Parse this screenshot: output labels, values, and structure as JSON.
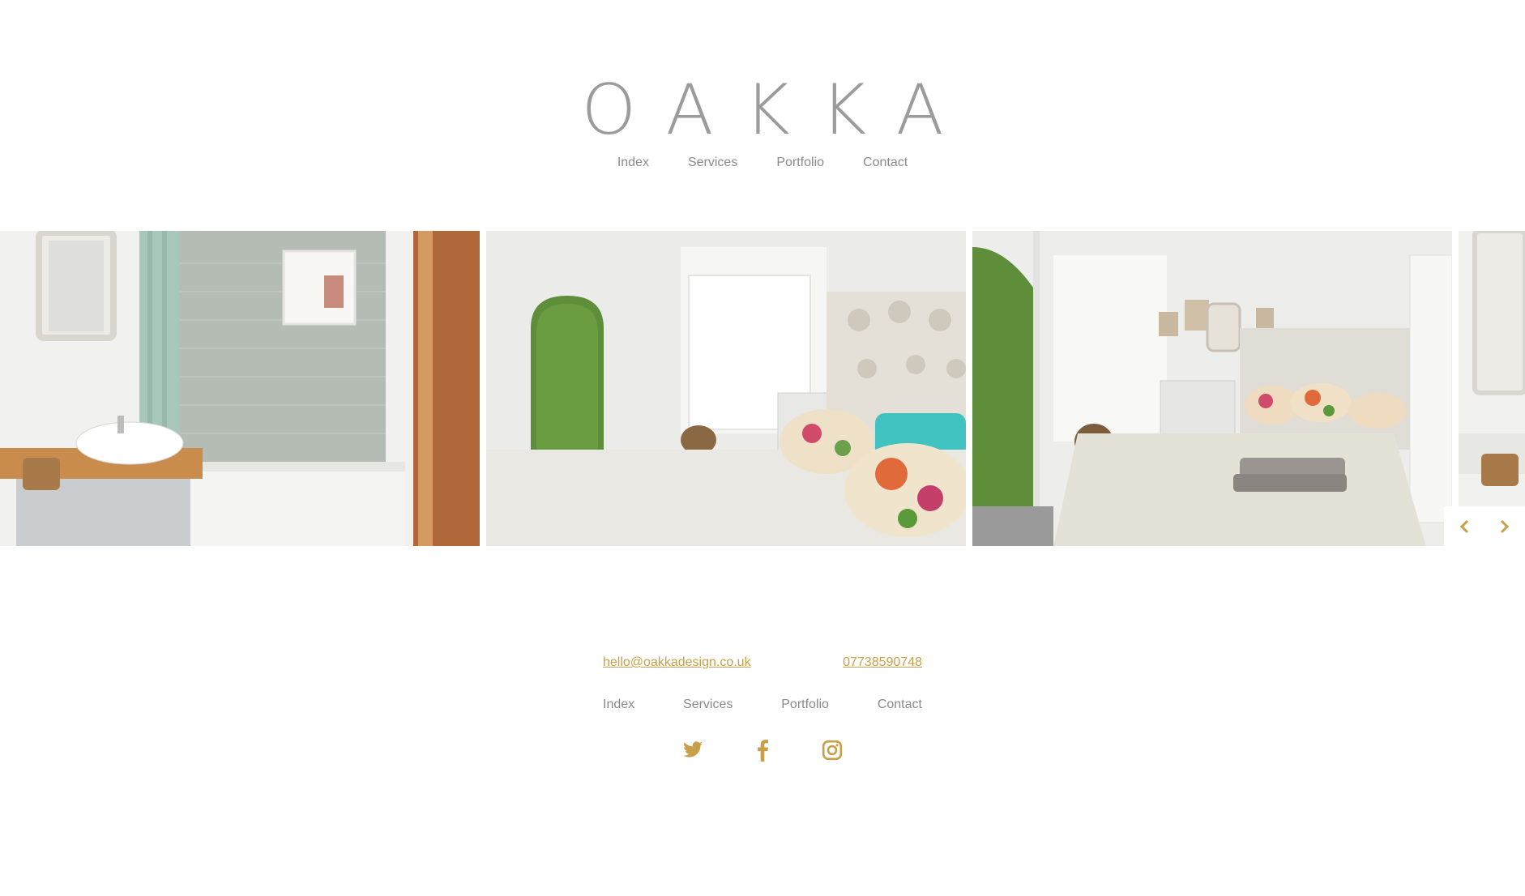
{
  "brand": {
    "logo_text": "OAKKA"
  },
  "main_nav": {
    "items": [
      {
        "label": "Index"
      },
      {
        "label": "Services"
      },
      {
        "label": "Portfolio"
      },
      {
        "label": "Contact"
      }
    ]
  },
  "gallery": {
    "slides": [
      {
        "subject": "bathroom"
      },
      {
        "subject": "bedroom-window"
      },
      {
        "subject": "bedroom-bed"
      },
      {
        "subject": "bathroom-partial"
      }
    ],
    "prev_icon": "chevron-left-icon",
    "next_icon": "chevron-right-icon"
  },
  "footer": {
    "email": "hello@oakkadesign.co.uk",
    "phone": "07738590748",
    "nav": [
      {
        "label": "Index"
      },
      {
        "label": "Services"
      },
      {
        "label": "Portfolio"
      },
      {
        "label": "Contact"
      }
    ],
    "social": [
      {
        "icon": "twitter-icon"
      },
      {
        "icon": "facebook-icon"
      },
      {
        "icon": "instagram-icon"
      }
    ]
  },
  "colors": {
    "accent": "#c9a049",
    "logo": "#9b9b9b",
    "nav_text": "#8a8a8a",
    "background": "#ffffff"
  }
}
